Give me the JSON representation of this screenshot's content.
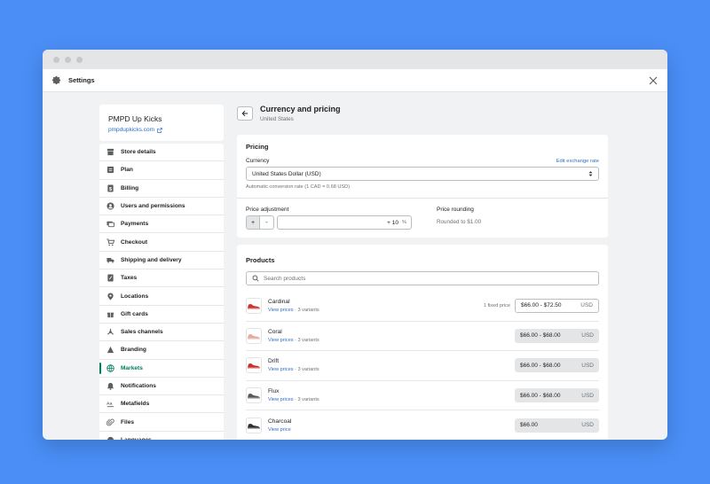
{
  "app": {
    "title": "Settings"
  },
  "store": {
    "name": "PMPD Up Kicks",
    "url": "pmpdupkicks.com"
  },
  "nav": [
    {
      "label": "Store details",
      "icon": "store-icon"
    },
    {
      "label": "Plan",
      "icon": "plan-icon"
    },
    {
      "label": "Billing",
      "icon": "billing-icon"
    },
    {
      "label": "Users and permissions",
      "icon": "user-icon"
    },
    {
      "label": "Payments",
      "icon": "payments-icon"
    },
    {
      "label": "Checkout",
      "icon": "cart-icon"
    },
    {
      "label": "Shipping and delivery",
      "icon": "truck-icon"
    },
    {
      "label": "Taxes",
      "icon": "tax-icon"
    },
    {
      "label": "Locations",
      "icon": "location-icon"
    },
    {
      "label": "Gift cards",
      "icon": "gift-icon"
    },
    {
      "label": "Sales channels",
      "icon": "channels-icon"
    },
    {
      "label": "Branding",
      "icon": "branding-icon"
    },
    {
      "label": "Markets",
      "icon": "globe-icon",
      "active": true
    },
    {
      "label": "Notifications",
      "icon": "bell-icon"
    },
    {
      "label": "Metafields",
      "icon": "metafields-icon"
    },
    {
      "label": "Files",
      "icon": "files-icon"
    },
    {
      "label": "Languages",
      "icon": "languages-icon"
    }
  ],
  "page": {
    "title": "Currency and pricing",
    "subtitle": "United States"
  },
  "pricing": {
    "title": "Pricing",
    "currency_label": "Currency",
    "edit_rate_link": "Edit exchange rate",
    "currency_value": "United States Dollar (USD)",
    "conversion_help": "Automatic conversion rate (1 CAD = 0.68 USD)",
    "adjustment_label": "Price adjustment",
    "plus": "+",
    "minus": "-",
    "adjustment_value": "+ 10",
    "adjustment_suffix": "%",
    "rounding_label": "Price rounding",
    "rounding_value": "Rounded to $1.00"
  },
  "products": {
    "title": "Products",
    "search_placeholder": "Search products",
    "items": [
      {
        "name": "Cardinal",
        "link": "View prices",
        "variants": "· 3 variants",
        "fixed_label": "1 fixed price",
        "price": "$66.00 - $72.50",
        "currency": "USD",
        "editable": true,
        "color": "#d0302a"
      },
      {
        "name": "Coral",
        "link": "View prices",
        "variants": "· 3 variants",
        "fixed_label": "",
        "price": "$66.00 - $68.00",
        "currency": "USD",
        "editable": false,
        "color": "#e8a89a"
      },
      {
        "name": "Drift",
        "link": "View prices",
        "variants": "· 3 variants",
        "fixed_label": "",
        "price": "$66.00 - $68.00",
        "currency": "USD",
        "editable": false,
        "color": "#c9302c"
      },
      {
        "name": "Flux",
        "link": "View prices",
        "variants": "· 3 variants",
        "fixed_label": "",
        "price": "$66.00 - $68.00",
        "currency": "USD",
        "editable": false,
        "color": "#555a60"
      },
      {
        "name": "Charcoal",
        "link": "View price",
        "variants": "",
        "fixed_label": "",
        "price": "$66.00",
        "currency": "USD",
        "editable": false,
        "color": "#2b2e33"
      }
    ]
  },
  "colors": {
    "accent": "#008060",
    "link": "#2c6ecb",
    "background": "#4a8ef6"
  }
}
